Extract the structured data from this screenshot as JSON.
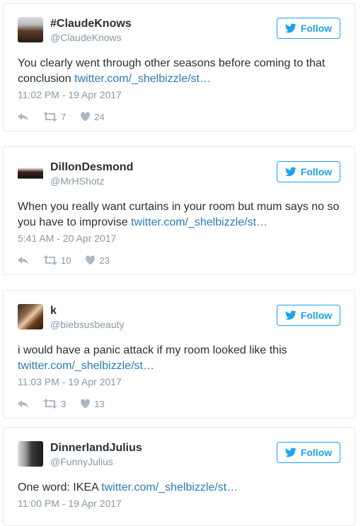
{
  "follow_label": "Follow",
  "tweets": [
    {
      "display_name": "#ClaudeKnows",
      "handle": "@ClaudeKnows",
      "text": "You clearly went through other seasons before coming to that conclusion ",
      "link": "twitter.com/_shelbizzle/st…",
      "timestamp": "11:02 PM - 19 Apr 2017",
      "retweets": "7",
      "likes": "24"
    },
    {
      "display_name": "DillonDesmond",
      "handle": "@MrHShotz",
      "text": "When you really want curtains in your room but mum says no so you have to improvise ",
      "link": "twitter.com/_shelbizzle/st…",
      "timestamp": "5:41 AM - 20 Apr 2017",
      "retweets": "10",
      "likes": "23"
    },
    {
      "display_name": "k",
      "handle": "@biebsusbeauty",
      "text": "i would have a panic attack if my room looked like this ",
      "link": "twitter.com/_shelbizzle/st…",
      "timestamp": "11:03 PM - 19 Apr 2017",
      "retweets": "3",
      "likes": "13"
    },
    {
      "display_name": "DinnerlandJulius",
      "handle": "@FunnyJulius",
      "text": "One word: IKEA ",
      "link": "twitter.com/_shelbizzle/st…",
      "timestamp": "11:00 PM - 19 Apr 2017"
    }
  ],
  "colors": {
    "accent": "#1da1f2",
    "link": "#2b7bb9",
    "muted": "#8899a6",
    "border": "#e1e8ed"
  },
  "icons": [
    "twitter-bird-icon",
    "reply-icon",
    "retweet-icon",
    "heart-icon"
  ]
}
